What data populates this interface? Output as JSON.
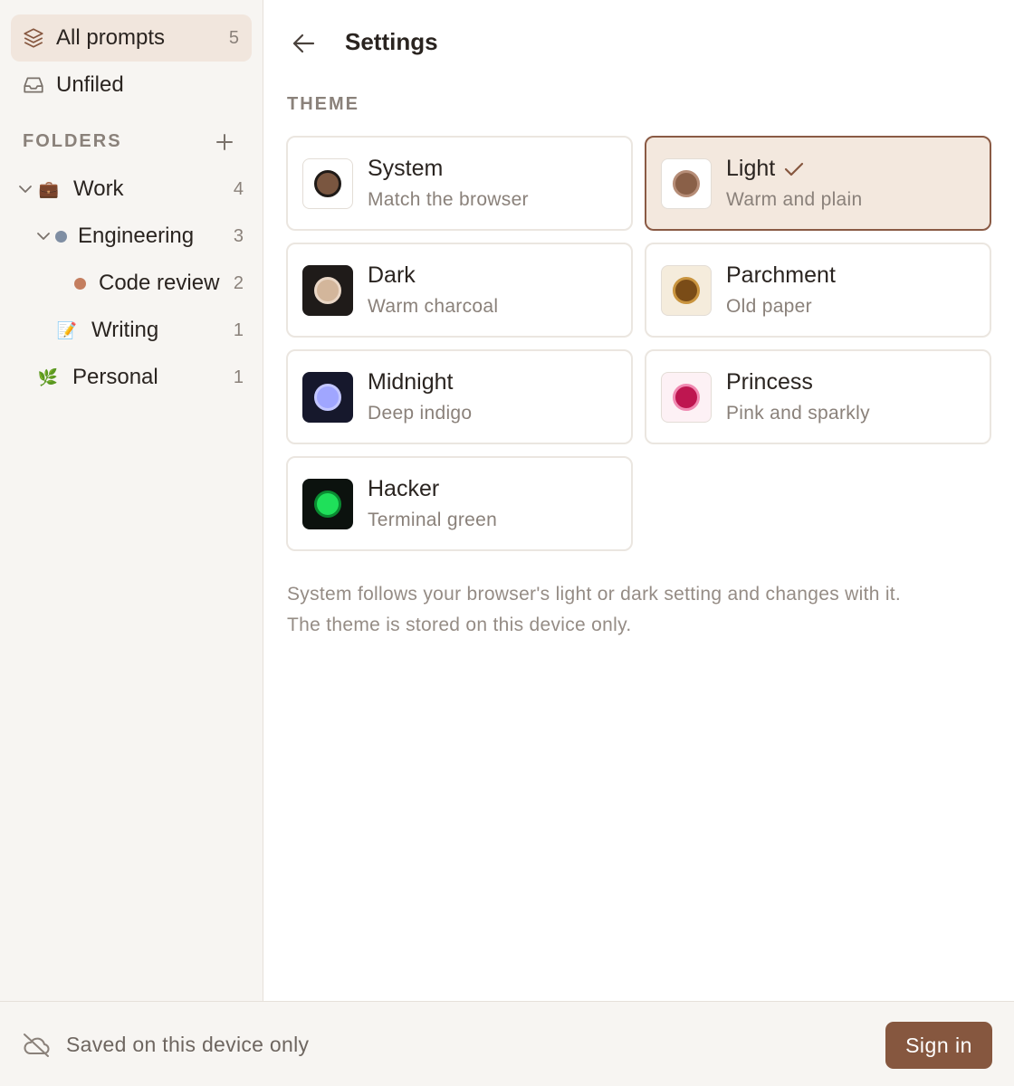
{
  "sidebar": {
    "all_prompts": {
      "label": "All prompts",
      "count": "5"
    },
    "unfiled": {
      "label": "Unfiled"
    },
    "folders_label": "FOLDERS",
    "tree": [
      {
        "label": "Work",
        "count": "4",
        "emoji": "💼"
      },
      {
        "label": "Engineering",
        "count": "3",
        "dot_color": "#7f8ea3"
      },
      {
        "label": "Code review",
        "count": "2",
        "dot_color": "#c47e5f"
      },
      {
        "label": "Writing",
        "count": "1",
        "emoji": "📝"
      },
      {
        "label": "Personal",
        "count": "1",
        "emoji": "🌿"
      }
    ]
  },
  "main": {
    "title": "Settings",
    "theme_label": "THEME",
    "themes": [
      {
        "name": "System",
        "desc": "Match the browser",
        "swatch_bg": "#ffffff",
        "dot": "#7a5640",
        "ring": "#1f1a17",
        "selected": false
      },
      {
        "name": "Light",
        "desc": "Warm and plain",
        "swatch_bg": "#ffffff",
        "dot": "#8a6048",
        "ring": "#b68d77",
        "selected": true
      },
      {
        "name": "Dark",
        "desc": "Warm charcoal",
        "swatch_bg": "#1f1b19",
        "dot": "#d3b69b",
        "ring": "#ead7c6",
        "selected": false
      },
      {
        "name": "Parchment",
        "desc": "Old paper",
        "swatch_bg": "#f5ecdc",
        "dot": "#7a4c17",
        "ring": "#c9943e",
        "selected": false
      },
      {
        "name": "Midnight",
        "desc": "Deep indigo",
        "swatch_bg": "#16182c",
        "dot": "#a0a6ff",
        "ring": "#c3c7ff",
        "selected": false
      },
      {
        "name": "Princess",
        "desc": "Pink and sparkly",
        "swatch_bg": "#fdf1f5",
        "dot": "#be1650",
        "ring": "#f08ab2",
        "selected": false
      },
      {
        "name": "Hacker",
        "desc": "Terminal green",
        "swatch_bg": "#0c120e",
        "dot": "#1fe05a",
        "ring": "#0a8a31",
        "selected": false
      }
    ],
    "footnote_line1": "System follows your browser's light or dark setting and changes with it.",
    "footnote_line2": "The theme is stored on this device only."
  },
  "footer": {
    "status_text": "Saved on this device only",
    "signin_label": "Sign in"
  },
  "colors": {
    "accent": "#86573f",
    "active_nav_bg": "#f1e6dd",
    "selected_card_bg": "#f3e8de"
  }
}
